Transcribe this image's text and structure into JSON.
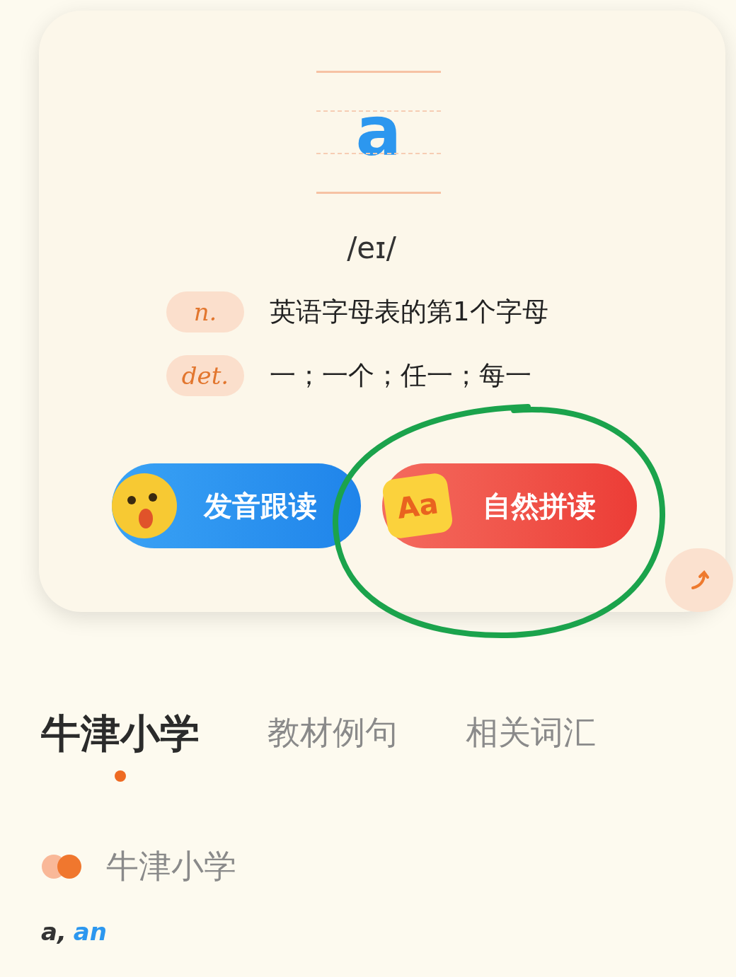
{
  "word": {
    "letter": "a",
    "phonetic": "/eɪ/",
    "definitions": [
      {
        "pos": "n.",
        "meaning": "英语字母表的第1个字母"
      },
      {
        "pos": "det.",
        "meaning": "一；一个；任一；每一"
      }
    ],
    "actions": [
      {
        "kind": "follow",
        "label": "发音跟读"
      },
      {
        "kind": "phonics",
        "label": "自然拼读",
        "icon_text": "Aa",
        "circled": true
      }
    ]
  },
  "tabs": [
    {
      "label": "牛津小学",
      "selected": true
    },
    {
      "label": "教材例句",
      "selected": false
    },
    {
      "label": "相关词汇",
      "selected": false
    }
  ],
  "section": {
    "title": "牛津小学",
    "forms": [
      {
        "text": "a,",
        "kind": "plain"
      },
      {
        "text": "an",
        "kind": "link"
      }
    ]
  }
}
